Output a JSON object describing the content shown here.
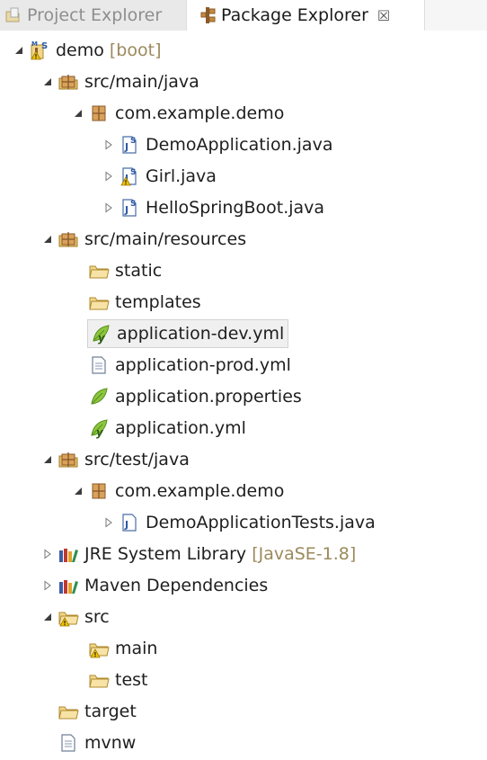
{
  "tabs": {
    "project_explorer": "Project Explorer",
    "package_explorer": "Package Explorer",
    "close_glyph": "☒"
  },
  "tree": [
    {
      "name": "tree-item-demo",
      "label": "demo",
      "decoration": "[boot]",
      "arrow": "expanded",
      "icon": "maven-project-icon"
    },
    {
      "name": "tree-item-src-main-java",
      "label": "src/main/java",
      "arrow": "expanded",
      "icon": "package-folder-icon"
    },
    {
      "name": "tree-item-com-example-demo",
      "label": "com.example.demo",
      "arrow": "expanded",
      "icon": "package-icon"
    },
    {
      "name": "tree-item-demoapplication-java",
      "label": "DemoApplication.java",
      "arrow": "collapsed",
      "icon": "spring-java-file-icon"
    },
    {
      "name": "tree-item-girl-java",
      "label": "Girl.java",
      "arrow": "collapsed",
      "icon": "spring-java-file-warning-icon"
    },
    {
      "name": "tree-item-hellospringboot-java",
      "label": "HelloSpringBoot.java",
      "arrow": "collapsed",
      "icon": "spring-java-file-icon"
    },
    {
      "name": "tree-item-src-main-resources",
      "label": "src/main/resources",
      "arrow": "expanded",
      "icon": "package-folder-icon"
    },
    {
      "name": "tree-item-static",
      "label": "static",
      "arrow": "none",
      "icon": "folder-icon"
    },
    {
      "name": "tree-item-templates",
      "label": "templates",
      "arrow": "none",
      "icon": "folder-icon"
    },
    {
      "name": "tree-item-application-dev-yml",
      "label": "application-dev.yml",
      "arrow": "none",
      "icon": "spring-yaml-icon",
      "selected": true
    },
    {
      "name": "tree-item-application-prod-yml",
      "label": "application-prod.yml",
      "arrow": "none",
      "icon": "text-file-icon"
    },
    {
      "name": "tree-item-application-properties",
      "label": "application.properties",
      "arrow": "none",
      "icon": "spring-leaf-icon"
    },
    {
      "name": "tree-item-application-yml",
      "label": "application.yml",
      "arrow": "none",
      "icon": "spring-yaml-icon"
    },
    {
      "name": "tree-item-src-test-java",
      "label": "src/test/java",
      "arrow": "expanded",
      "icon": "package-folder-icon"
    },
    {
      "name": "tree-item-com-example-demo-test",
      "label": "com.example.demo",
      "arrow": "expanded",
      "icon": "package-icon"
    },
    {
      "name": "tree-item-demoapplicationtests-java",
      "label": "DemoApplicationTests.java",
      "arrow": "collapsed",
      "icon": "java-file-icon"
    },
    {
      "name": "tree-item-jre-system-library",
      "label": "JRE System Library",
      "decoration": "[JavaSE-1.8]",
      "arrow": "collapsed",
      "icon": "library-icon"
    },
    {
      "name": "tree-item-maven-dependencies",
      "label": "Maven Dependencies",
      "arrow": "collapsed",
      "icon": "library-icon"
    },
    {
      "name": "tree-item-src",
      "label": "src",
      "arrow": "expanded",
      "icon": "folder-warning-icon"
    },
    {
      "name": "tree-item-main",
      "label": "main",
      "arrow": "none",
      "icon": "folder-warning-icon"
    },
    {
      "name": "tree-item-test",
      "label": "test",
      "arrow": "none",
      "icon": "folder-icon"
    },
    {
      "name": "tree-item-target",
      "label": "target",
      "arrow": "none",
      "icon": "folder-icon"
    },
    {
      "name": "tree-item-mvnw",
      "label": "mvnw",
      "arrow": "none",
      "icon": "text-file-icon"
    }
  ]
}
